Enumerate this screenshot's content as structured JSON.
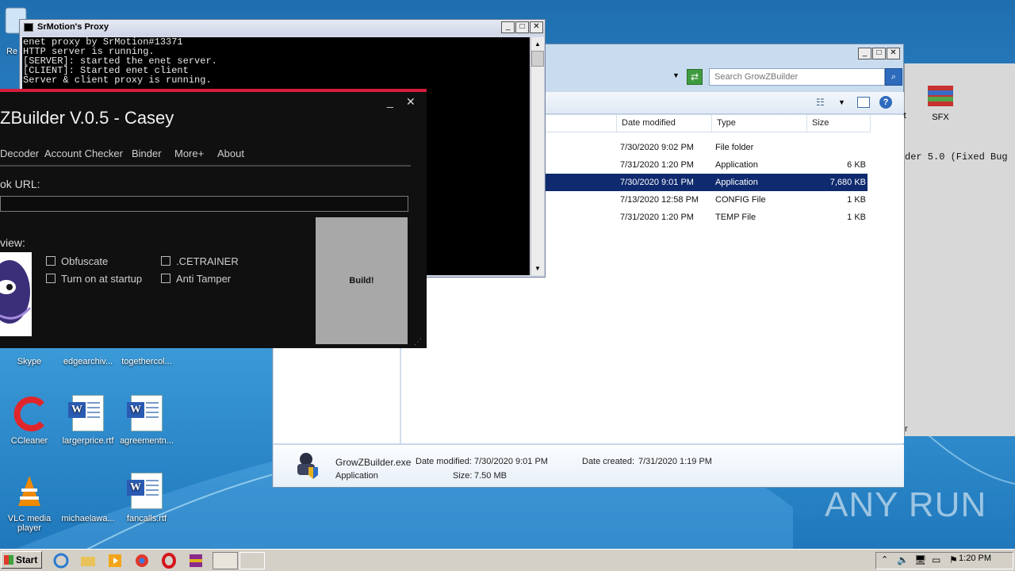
{
  "desktop": {
    "icons": [
      {
        "label": "Re",
        "name": "recycle-bin"
      },
      {
        "label": "Skype",
        "name": "skype"
      },
      {
        "label": "edgearchiv...",
        "name": "edgearchive"
      },
      {
        "label": "togethercol...",
        "name": "togethercol"
      },
      {
        "label": "CCleaner",
        "name": "ccleaner"
      },
      {
        "label": "largerprice.rtf",
        "name": "largerprice"
      },
      {
        "label": "agreementn...",
        "name": "agreementn"
      },
      {
        "label": "VLC media player",
        "name": "vlc"
      },
      {
        "label": "michaelawa...",
        "name": "michaelawa"
      },
      {
        "label": "fancalls.rtf",
        "name": "fancalls"
      },
      {
        "label": "ent",
        "name": "ent"
      },
      {
        "label": "SFX",
        "name": "sfx"
      }
    ],
    "watermark": "ANY RUN"
  },
  "explorer": {
    "search_placeholder": "Search GrowZBuilder",
    "columns": [
      "Date modified",
      "Type",
      "Size"
    ],
    "rows": [
      {
        "date": "7/30/2020 9:02 PM",
        "type": "File folder",
        "size": ""
      },
      {
        "date": "7/31/2020 1:20 PM",
        "type": "Application",
        "size": "6 KB"
      },
      {
        "date": "7/30/2020 9:01 PM",
        "type": "Application",
        "size": "7,680 KB"
      },
      {
        "date": "7/13/2020 12:58 PM",
        "type": "CONFIG File",
        "size": "1 KB"
      },
      {
        "date": "7/31/2020 1:20 PM",
        "type": "TEMP File",
        "size": "1 KB"
      }
    ],
    "details": {
      "name": "GrowZBuilder.exe",
      "date_modified_label": "Date modified:",
      "date_modified": "7/30/2020 9:01 PM",
      "date_created_label": "Date created:",
      "date_created": "7/31/2020 1:19 PM",
      "kind": "Application",
      "size_label": "Size:",
      "size": "7.50 MB"
    }
  },
  "behind_window": {
    "text": "der 5.0 (Fixed Bug",
    "bottom_text": "r"
  },
  "console": {
    "title": "SrMotion's Proxy",
    "lines": [
      "enet proxy by SrMotion#13371",
      "HTTP server is running.",
      "[SERVER]: started the enet server.",
      "[CLIENT]: Started enet client",
      "Server & client proxy is running."
    ]
  },
  "builder": {
    "title": "ZBuilder V.0.5 - Casey",
    "menu": [
      "Decoder",
      "Account Checker",
      "Binder",
      "More+",
      "About"
    ],
    "url_label": "ok URL:",
    "preview_label": "view:",
    "options": [
      "Obfuscate",
      ".CETRAINER",
      "Turn on at startup",
      "Anti Tamper"
    ],
    "build_label": "Build!"
  },
  "taskbar": {
    "start_label": "Start",
    "clock": "1:20 PM"
  }
}
